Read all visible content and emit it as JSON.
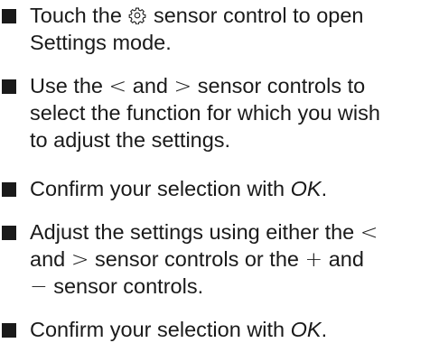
{
  "instructions": [
    {
      "lines": [
        [
          "Touch the ",
          {
            "icon": "gear-icon"
          },
          " sensor control to open"
        ],
        [
          "Settings mode."
        ]
      ]
    },
    {
      "lines": [
        [
          "Use the ",
          {
            "sym": "<"
          },
          " and ",
          {
            "sym": ">"
          },
          " sensor controls to"
        ],
        [
          "select the function for which you wish"
        ],
        [
          "to adjust the settings."
        ]
      ]
    },
    {
      "lines": [
        [
          "Confirm your selection with ",
          {
            "em": "OK"
          },
          "."
        ]
      ]
    },
    {
      "lines": [
        [
          "Adjust the settings using either the ",
          {
            "sym": "<"
          }
        ],
        [
          "and ",
          {
            "sym": ">"
          },
          " sensor controls or the ",
          {
            "sym": "+"
          },
          " and"
        ],
        [
          {
            "sym": "−"
          },
          " sensor controls."
        ]
      ]
    },
    {
      "lines": [
        [
          "Confirm your selection with ",
          {
            "em": "OK"
          },
          "."
        ]
      ]
    }
  ]
}
